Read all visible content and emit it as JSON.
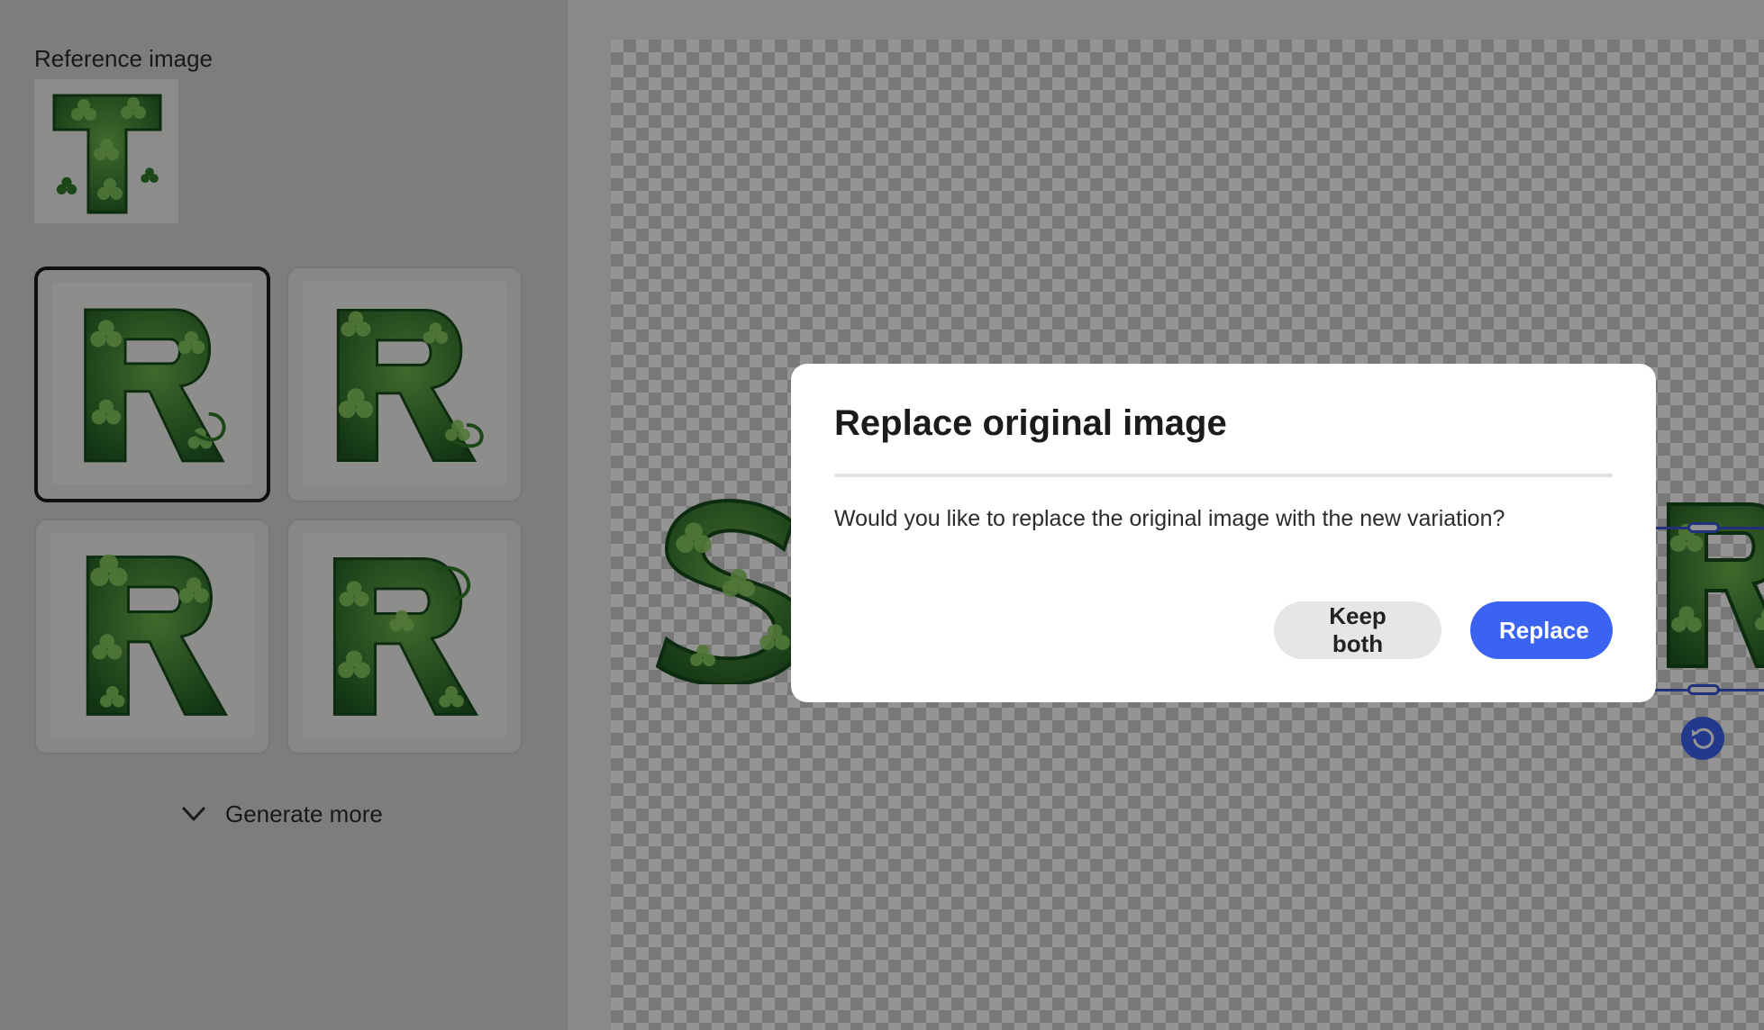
{
  "left_panel": {
    "reference_label": "Reference image",
    "reference_icon": "letter-t-clover-image",
    "variations": [
      {
        "icon": "letter-r-clover-image",
        "selected": true
      },
      {
        "icon": "letter-r-clover-image",
        "selected": false
      },
      {
        "icon": "letter-r-clover-image",
        "selected": false
      },
      {
        "icon": "letter-r-clover-image",
        "selected": false
      }
    ],
    "generate_more_label": "Generate more"
  },
  "dialog": {
    "title": "Replace original image",
    "message": "Would you like to replace the original image with the new variation?",
    "secondary_button": "Keep both",
    "primary_button": "Replace"
  },
  "colors": {
    "accent": "#3b63f2",
    "clover_dark": "#1f5a22",
    "clover_light": "#4f9a3c"
  }
}
